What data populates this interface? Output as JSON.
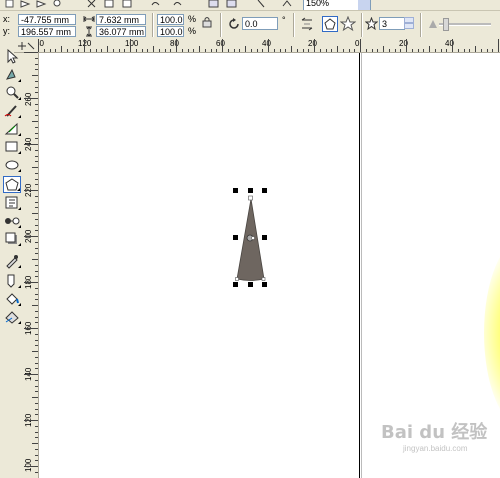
{
  "toolbar": {
    "zoom_value": "150%"
  },
  "property_bar": {
    "x_label": "x:",
    "y_label": "y:",
    "x_value": "-47.755 mm",
    "y_value": "196.557 mm",
    "width_value": "7.632 mm",
    "height_value": "36.077 mm",
    "scale_x": "100.0",
    "scale_y": "100.0",
    "percent": "%",
    "rotation_value": "0.0",
    "degree": "°",
    "points_value": "3"
  },
  "h_ruler": {
    "labels": [
      "40",
      "120",
      "100",
      "80",
      "60",
      "40",
      "20",
      "0",
      "20",
      "40"
    ]
  },
  "v_ruler": {
    "labels": [
      "260",
      "240",
      "220",
      "200",
      "180",
      "160",
      "140",
      "120",
      "100"
    ]
  },
  "watermark": {
    "text": "Bai du 经验",
    "url": "jingyan.baidu.com"
  },
  "colors": {
    "shape_fill": "#6e6660",
    "chrome": "#ece9d8",
    "field_border": "#7f9db9",
    "selection_handle": "#000000"
  },
  "icons": [
    "select-tool-icon",
    "shape-tool-icon",
    "zoom-tool-icon",
    "freehand-tool-icon",
    "smart-fill-icon",
    "rectangle-tool-icon",
    "ellipse-tool-icon",
    "polygon-tool-icon",
    "text-tool-icon",
    "interactive-blend-icon",
    "drop-shadow-icon",
    "eyedropper-icon",
    "outline-tool-icon",
    "fill-tool-icon",
    "interactive-fill-icon",
    "polygon-icon",
    "star-icon",
    "rotate-icon",
    "lock-ratio-icon"
  ]
}
